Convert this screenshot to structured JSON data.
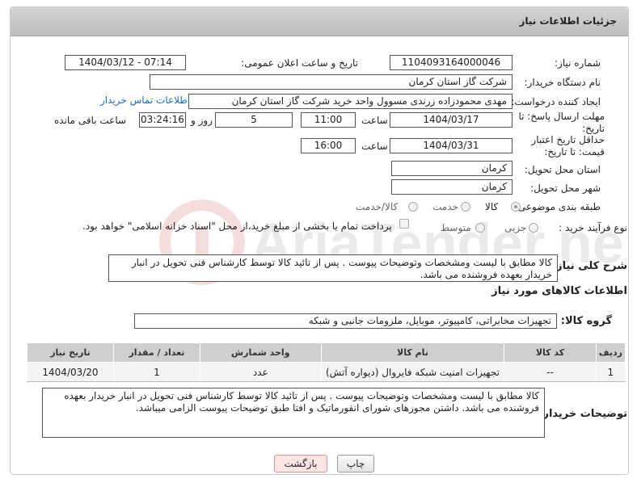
{
  "header": {
    "title": "جزئیات اطلاعات نیاز"
  },
  "fields": {
    "need_number": {
      "label": "شماره نیاز:",
      "value": "1104093164000046"
    },
    "announce_datetime": {
      "label": "تاریخ و ساعت اعلان عمومی:",
      "value": "1404/03/12 - 07:14"
    },
    "buyer_org": {
      "label": "نام دستگاه خریدار:",
      "value": "شرکت گاز استان کرمان"
    },
    "requester": {
      "label": "ایجاد کننده درخواست:",
      "value": "مهدی محمودزاده زرندی مسوول واحد خرید شرکت گاز استان کرمان",
      "contact_link": "اطلاعات تماس خریدار"
    },
    "reply_deadline": {
      "label": "مهلت ارسال پاسخ: تا تاریخ:",
      "date": "1404/03/17",
      "time_label": "ساعت",
      "time": "11:00",
      "days": "5",
      "days_label": "روز و",
      "remaining": "03:24:16",
      "remaining_label": "ساعت باقی مانده"
    },
    "price_validity": {
      "label": "حداقل تاریخ اعتبار قیمت: تا تاریخ:",
      "date": "1404/03/31",
      "time_label": "ساعت",
      "time": "16:00"
    },
    "delivery_province": {
      "label": "استان محل تحویل:",
      "value": "کرمان"
    },
    "delivery_city": {
      "label": "شهر محل تحویل:",
      "value": "کرمان"
    },
    "subject_category": {
      "label": "طبقه بندی موضوعی:",
      "options": [
        "کالا",
        "خدمت",
        "کالا/خدمت"
      ],
      "selected": "کالا"
    },
    "purchase_type": {
      "label": "نوع فرآیند خرید :",
      "options": [
        "جزیی",
        "متوسط"
      ],
      "payment_note": "پرداخت تمام یا بخشی از مبلغ خرید،از محل \"اسناد خزانه اسلامی\" خواهد بود."
    }
  },
  "description": {
    "label": "شرح کلی نیاز:",
    "value": "کالا مطابق با لیست ومشخصات وتوضیحات پیوست . پس از تائید کالا توسط کارشناس فنی تحویل در انبار خریدار بعهده فروشنده می باشد."
  },
  "goods_section": {
    "title": "اطلاعات کالاهای مورد نیاز",
    "group_label": "گروه کالا:",
    "group_value": "تجهیزات مخابراتی، کامپیوتر، موبایل، ملزومات جانبی و شبکه"
  },
  "table": {
    "headers": [
      "ردیف",
      "کد کالا",
      "نام کالا",
      "واحد شمارش",
      "تعداد / مقدار",
      "تاریخ نیاز"
    ],
    "rows": [
      [
        "1",
        "--",
        "تجهیزات امنیت شبکه فایروال (دیواره آتش)",
        "عدد",
        "1",
        "1404/03/20"
      ]
    ]
  },
  "buyer_notes": {
    "label": "توضیحات خریدار:",
    "value": "کالا مطابق با لیست ومشخصات وتوضیحات پیوست . پس از تائید کالا توسط کارشناس فنی تحویل در انبار خریدار بعهده فروشنده می باشد. داشتن مجوزهای شورای انفورماتیک و افتا طبق توضیحات پیوست الزامی میباشد."
  },
  "buttons": {
    "print": "چاپ",
    "back": "بازگشت"
  },
  "watermark": {
    "text": "AriaTender.net"
  }
}
